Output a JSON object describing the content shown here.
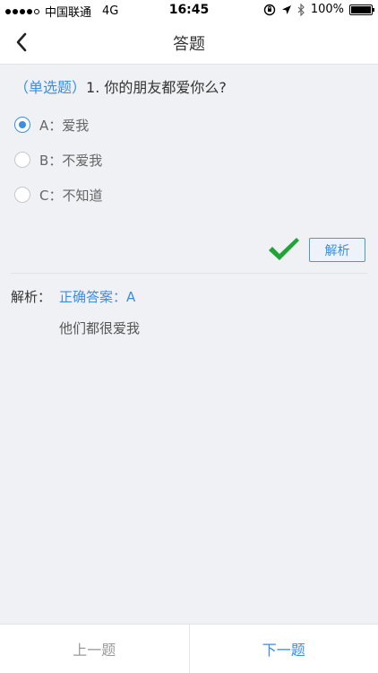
{
  "status_bar": {
    "carrier": "中国联通",
    "network": "4G",
    "time": "16:45",
    "battery": "100%",
    "icons": [
      "signal-dots-icon",
      "orientation-lock-icon",
      "location-arrow-icon",
      "bluetooth-icon",
      "battery-icon"
    ]
  },
  "nav": {
    "title": "答题",
    "back_icon": "chevron-left-icon"
  },
  "question": {
    "type_tag": "（单选题）",
    "text": "1. 你的朋友都爱你么?"
  },
  "options": [
    {
      "label": "A：爱我",
      "selected": true
    },
    {
      "label": "B：不爱我",
      "selected": false
    },
    {
      "label": "C：不知道",
      "selected": false
    }
  ],
  "result": {
    "icon": "checkmark-icon",
    "analysis_button": "解析"
  },
  "analysis": {
    "label": "解析：",
    "correct_answer": "正确答案：A",
    "explanation": "他们都很爱我"
  },
  "footer": {
    "prev": "上一题",
    "next": "下一题"
  },
  "colors": {
    "accent": "#3a8ee6",
    "check": "#1fa535",
    "background": "#f0f1f5"
  }
}
